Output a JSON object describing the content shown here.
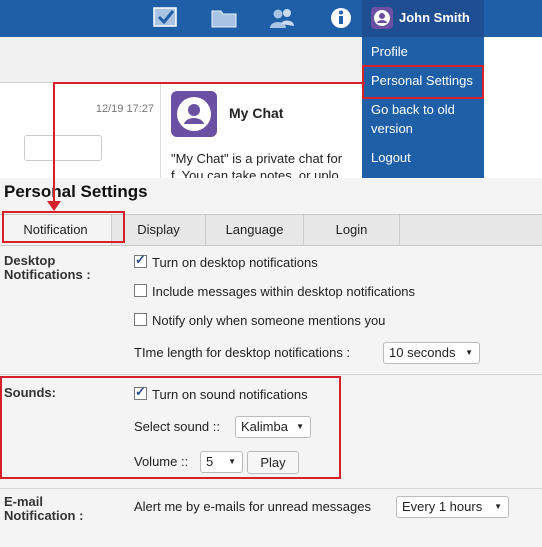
{
  "header": {
    "user_name": "John Smith",
    "icons": [
      "checkbox-icon",
      "folder-icon",
      "users-icon",
      "info-icon",
      "user-avatar-icon"
    ]
  },
  "background": {
    "timestamp": "12/19 17:27",
    "chat_title": "My Chat",
    "chat_desc_line1": "\"My Chat\" is a private chat for",
    "chat_desc_line2": "f. You can take notes, or uplo"
  },
  "menu": {
    "items": [
      "Profile",
      "Personal Settings",
      "Go back to old version",
      "Logout"
    ]
  },
  "settings": {
    "title": "Personal Settings",
    "tabs": [
      "Notification",
      "Display",
      "Language",
      "Login"
    ],
    "desktop": {
      "label_line1": "Desktop",
      "label_line2": "Notifications :",
      "opt1": "Turn on desktop notifications",
      "opt1_checked": true,
      "opt2": "Include messages within desktop notifications",
      "opt2_checked": false,
      "opt3": "Notify only when someone mentions you",
      "opt3_checked": false,
      "time_label": "TIme length for desktop notifications :",
      "time_value": "10 seconds"
    },
    "sounds": {
      "label": "Sounds:",
      "opt1": "Turn on sound notifications",
      "opt1_checked": true,
      "select_label": "Select sound ::",
      "sound_value": "Kalimba",
      "volume_label": "Volume ::",
      "volume_value": "5",
      "play_label": "Play"
    },
    "email": {
      "label_line1": "E-mail",
      "label_line2": "Notification :",
      "text": "Alert me by e-mails for unread messages",
      "value": "Every 1 hours"
    }
  },
  "colors": {
    "header_bg": "#1e5fa8",
    "highlight": "#d6202a"
  }
}
